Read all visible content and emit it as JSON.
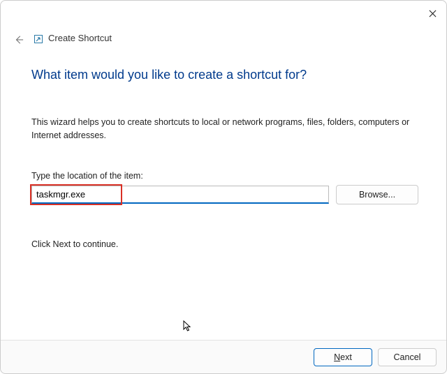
{
  "window": {
    "title": "Create Shortcut"
  },
  "main": {
    "heading": "What item would you like to create a shortcut for?",
    "description": "This wizard helps you to create shortcuts to local or network programs, files, folders, computers or Internet addresses.",
    "location_label": "Type the location of the item:",
    "location_value": "taskmgr.exe",
    "browse_label": "Browse...",
    "continue_text": "Click Next to continue."
  },
  "footer": {
    "next_label": "Next",
    "cancel_label": "Cancel"
  }
}
